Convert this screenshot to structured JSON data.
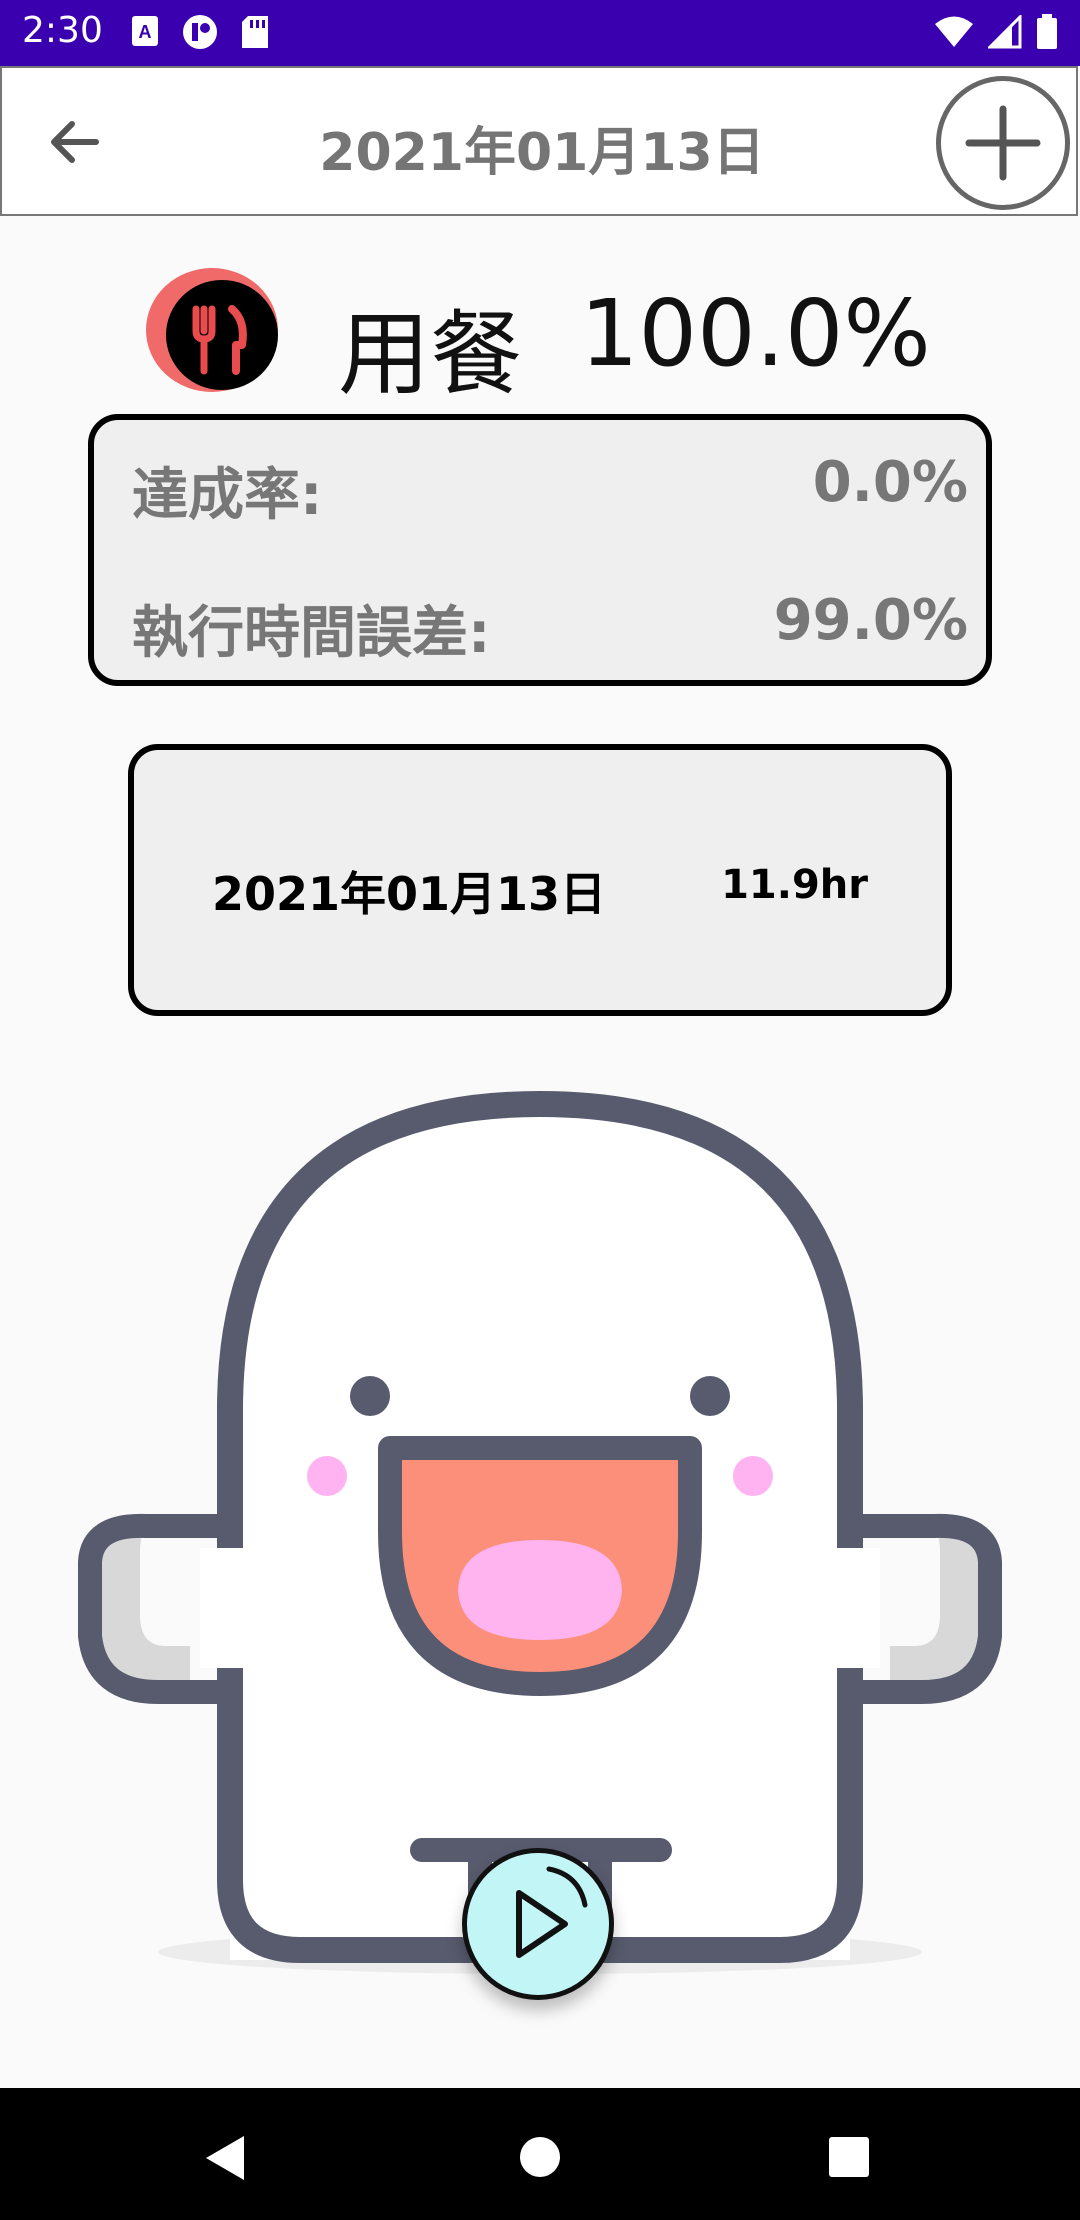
{
  "status_bar": {
    "time": "2:30",
    "left_icons": [
      "a-notification-icon",
      "app-notification-icon",
      "sd-card-icon"
    ],
    "right_icons": [
      "wifi-icon",
      "signal-icon",
      "battery-icon"
    ]
  },
  "app_bar": {
    "title": "2021年01月13日",
    "back_icon": "arrow-left-icon",
    "add_icon": "plus-circle-icon"
  },
  "category": {
    "icon": "fork-knife-icon",
    "name": "用餐",
    "percent": "100.0%",
    "icon_colors": {
      "outer": "#f06a6a",
      "inner": "#000000",
      "glyph": "#e84c4c"
    }
  },
  "stats": [
    {
      "label": "達成率:",
      "value": "0.0%"
    },
    {
      "label": "執行時間誤差:",
      "value": "99.0%"
    }
  ],
  "records": [
    {
      "date": "2021年01月13日",
      "hours": "11.9hr"
    }
  ],
  "mascot": {
    "description_icon": "happy-ghost-illustration-icon"
  },
  "play_button": {
    "icon": "play-icon",
    "color": "#c2f6f6"
  },
  "nav_bar": {
    "icons": [
      "nav-back-icon",
      "nav-home-icon",
      "nav-recents-icon"
    ]
  },
  "colors": {
    "status_bar": "#3a00b0",
    "title_text": "#757575",
    "card_bg": "#efefef",
    "mascot_outline": "#575b6d",
    "mascot_mouth": "#fb8f7a",
    "mascot_tongue": "#ffb3ef",
    "mascot_cheek": "#ffb3f0"
  }
}
